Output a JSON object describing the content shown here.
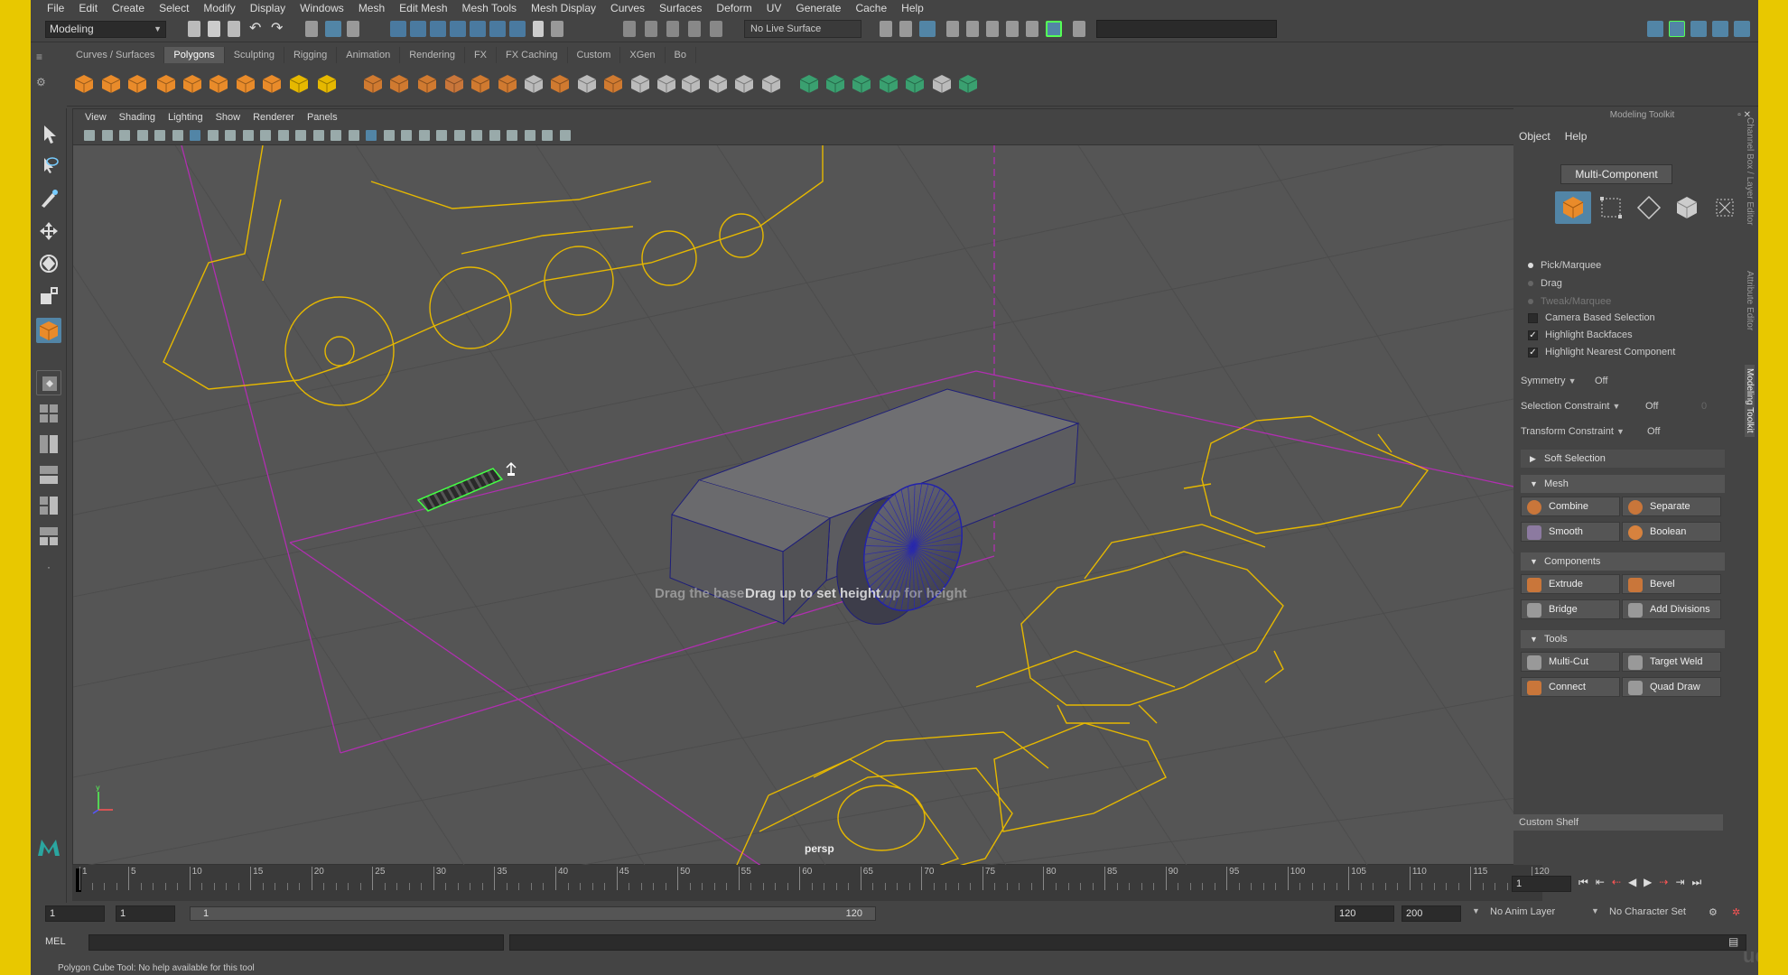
{
  "menubar": [
    "File",
    "Edit",
    "Create",
    "Select",
    "Modify",
    "Display",
    "Windows",
    "Mesh",
    "Edit Mesh",
    "Mesh Tools",
    "Mesh Display",
    "Curves",
    "Surfaces",
    "Deform",
    "UV",
    "Generate",
    "Cache",
    "Help"
  ],
  "statusline": {
    "mode": "Modeling",
    "live_surface": "No Live Surface"
  },
  "shelf": {
    "tabs": [
      "Curves / Surfaces",
      "Polygons",
      "Sculpting",
      "Rigging",
      "Animation",
      "Rendering",
      "FX",
      "FX Caching",
      "Custom",
      "XGen",
      "Bo"
    ],
    "active_tab": "Polygons"
  },
  "viewport": {
    "menu": [
      "View",
      "Shading",
      "Lighting",
      "Show",
      "Renderer",
      "Panels"
    ],
    "hud_help_back": "Drag the base",
    "hud_help_front": "Drag up to set height.",
    "hud_help_tail": "up for height",
    "camera": "persp"
  },
  "toolkit": {
    "title": "Modeling Toolkit",
    "menu": [
      "Object",
      "Help"
    ],
    "mode_button": "Multi-Component",
    "radios": [
      {
        "label": "Pick/Marquee",
        "on": true,
        "dim": false
      },
      {
        "label": "Drag",
        "on": false,
        "dim": false
      },
      {
        "label": "Tweak/Marquee",
        "on": false,
        "dim": true
      }
    ],
    "checks": [
      {
        "label": "Camera Based Selection",
        "checked": false
      },
      {
        "label": "Highlight Backfaces",
        "checked": true
      },
      {
        "label": "Highlight Nearest Component",
        "checked": true
      }
    ],
    "symmetry": {
      "label": "Symmetry",
      "value": "Off"
    },
    "selection_constraint": {
      "label": "Selection Constraint",
      "value": "Off",
      "extra": "0"
    },
    "transform_constraint": {
      "label": "Transform Constraint",
      "value": "Off"
    },
    "soft_selection": "Soft Selection",
    "mesh_section": "Mesh",
    "mesh_buttons": [
      "Combine",
      "Separate",
      "Smooth",
      "Boolean"
    ],
    "components_section": "Components",
    "component_buttons": [
      "Extrude",
      "Bevel",
      "Bridge",
      "Add Divisions"
    ],
    "tools_section": "Tools",
    "tool_buttons": [
      "Multi-Cut",
      "Target Weld",
      "Connect",
      "Quad Draw"
    ],
    "custom_shelf": "Custom Shelf",
    "side_tabs": [
      "Channel Box / Layer Editor",
      "Attribute Editor",
      "Modeling Toolkit"
    ]
  },
  "timeline": {
    "labels": [
      "1",
      "5",
      "10",
      "15",
      "20",
      "25",
      "30",
      "35",
      "40",
      "45",
      "50",
      "55",
      "60",
      "65",
      "70",
      "75",
      "80",
      "85",
      "90",
      "95",
      "100",
      "105",
      "110",
      "115",
      "120"
    ],
    "current_frame": "1"
  },
  "range": {
    "start": "1",
    "inner_start": "1",
    "bar_start": "1",
    "bar_end": "120",
    "end": "120",
    "max": "200",
    "anim_layer": "No Anim Layer",
    "char_set": "No Character Set"
  },
  "cmdline": {
    "label": "MEL"
  },
  "helpline": "Polygon Cube Tool: No help available for this tool",
  "watermark": "udemy",
  "colors": {
    "accent": "#5285a6",
    "wire_yellow": "#e6b800",
    "frame": "#e8c800",
    "selection_green": "#5f5"
  }
}
